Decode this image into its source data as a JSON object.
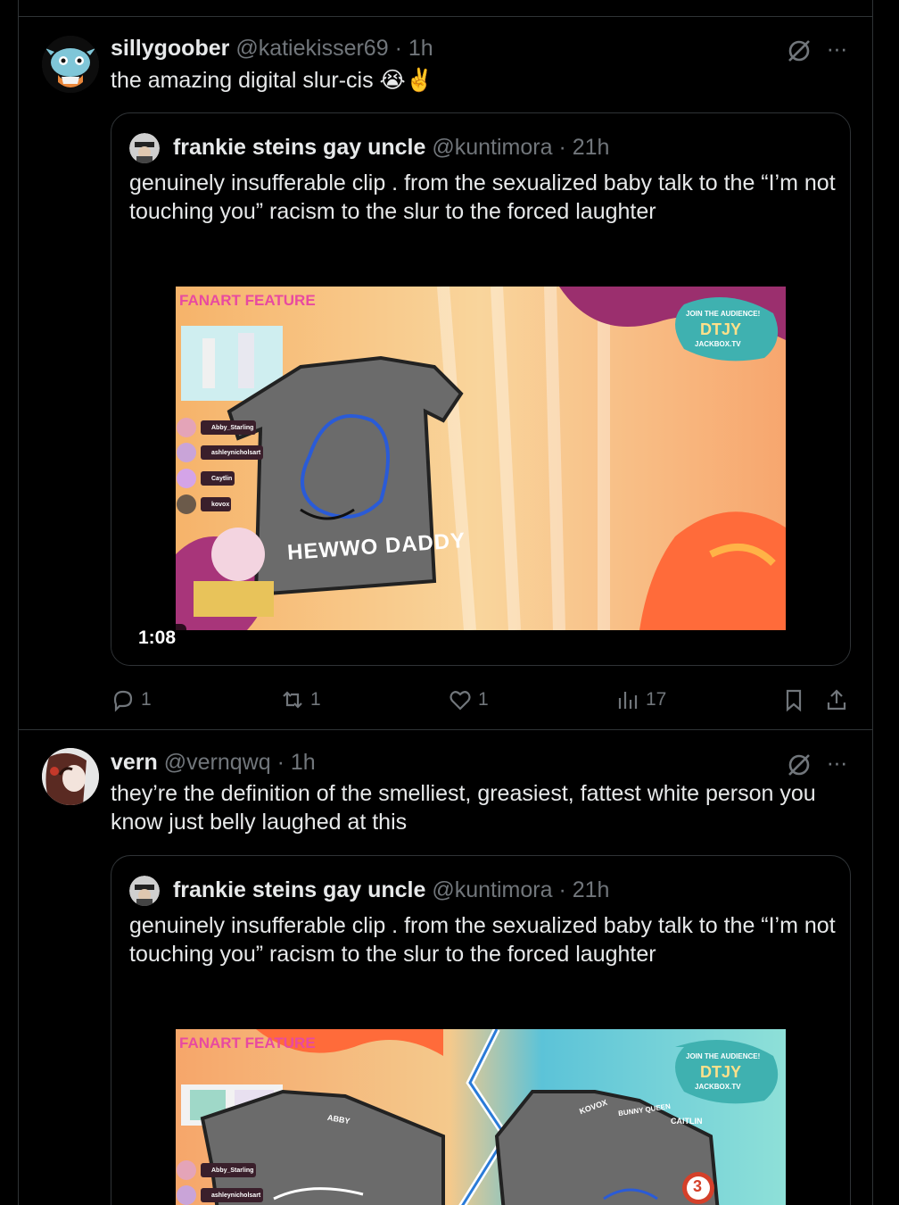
{
  "posts": [
    {
      "display_name": "sillygoober",
      "handle": "@katiekisser69",
      "time": "· 1h",
      "text": "the amazing digital slur-cis 😭✌️",
      "quote": {
        "display_name": "frankie steins gay uncle",
        "handle": "@kuntimora",
        "time": "· 21h",
        "text": "genuinely insufferable clip . from the sexualized baby talk to the “I’m not touching you” racism to the slur to the forced laughter",
        "video": {
          "duration": "1:08",
          "overlay_title": "FANART FEATURE",
          "shirt_text": "HEWWO DADDY",
          "badge_line1": "JOIN THE AUDIENCE!",
          "badge_logo": "DTJY",
          "badge_line2": "JACKBOX.TV",
          "players": [
            "Abby_Starling",
            "ashleynicholsart",
            "Caytlin",
            "kovox"
          ]
        }
      },
      "actions": {
        "replies": "1",
        "reposts": "1",
        "likes": "1",
        "views": "17"
      }
    },
    {
      "display_name": "vern",
      "handle": "@vernqwq",
      "time": "· 1h",
      "text": "they’re the definition of the smelliest, greasiest, fattest white person you know just belly laughed at this",
      "quote": {
        "display_name": "frankie steins gay uncle",
        "handle": "@kuntimora",
        "time": "· 21h",
        "text": "genuinely insufferable clip . from the sexualized baby talk to the “I’m not touching you” racism to the slur to the forced laughter",
        "video": {
          "overlay_title": "FANART FEATURE",
          "badge_line1": "JOIN THE AUDIENCE!",
          "badge_logo": "DTJY",
          "badge_line2": "JACKBOX.TV",
          "shirt_tags": [
            "ABBY",
            "KOVOX",
            "BUNNY QUEEN",
            "CAITLIN"
          ],
          "rank": "3",
          "players": [
            "Abby_Starling",
            "ashleynicholsart"
          ]
        }
      }
    }
  ]
}
